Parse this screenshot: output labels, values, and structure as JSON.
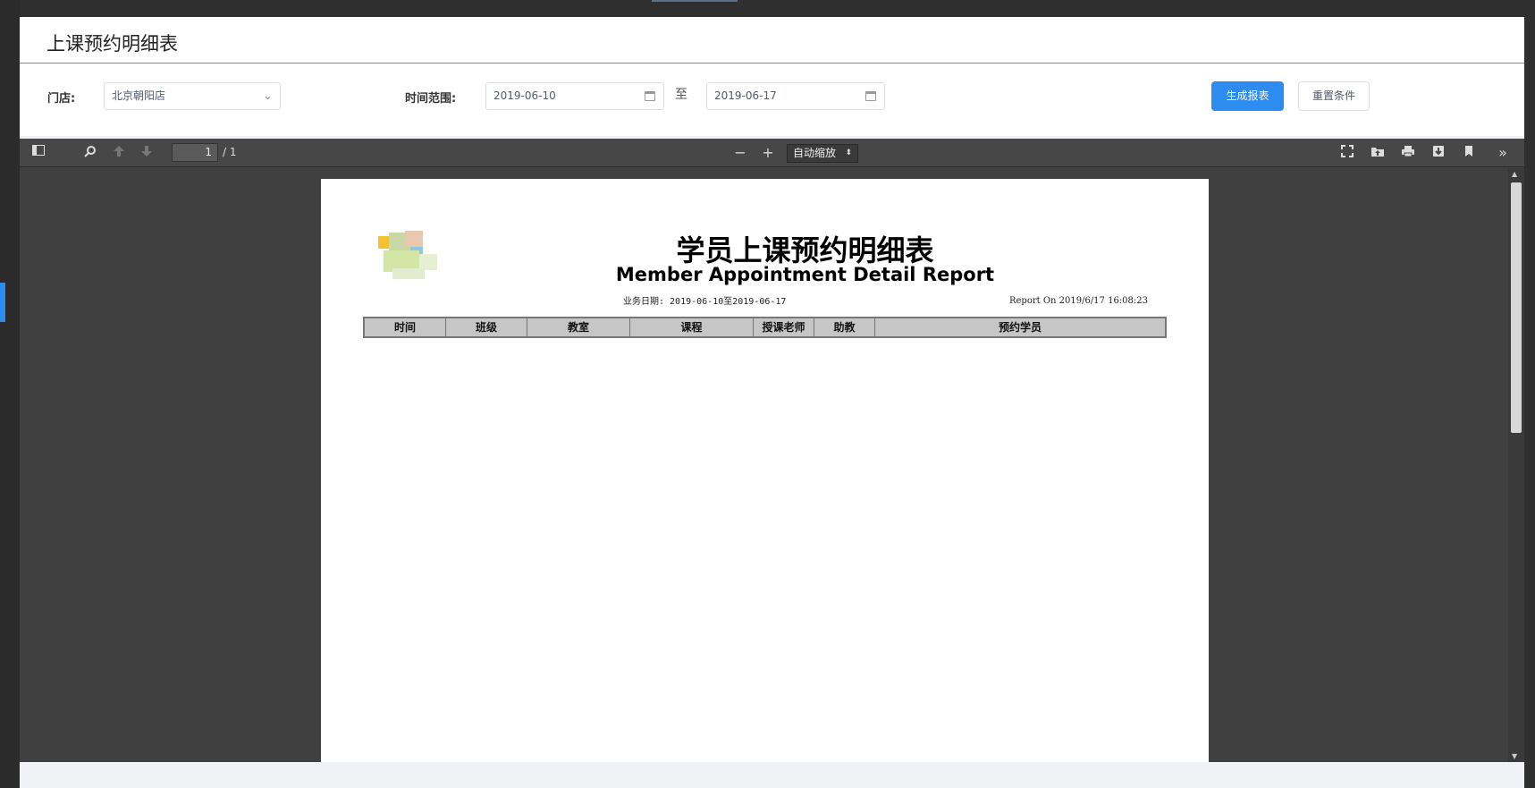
{
  "page": {
    "title": "上课预约明细表"
  },
  "filters": {
    "store_label": "门店:",
    "store_value": "北京朝阳店",
    "time_label": "时间范围:",
    "start_date": "2019-06-10",
    "range_separator": "至",
    "end_date": "2019-06-17",
    "generate_button": "生成报表",
    "reset_button": "重置条件"
  },
  "viewer": {
    "page_number": "1",
    "page_count": "/ 1",
    "zoom": "自动缩放",
    "zoom_out": "−",
    "zoom_in": "+"
  },
  "report": {
    "title_cn": "学员上课预约明细表",
    "title_en": "Member Appointment Detail Report",
    "business_date": "业务日期: 2019-06-10至2019-06-17",
    "report_on": "Report On 2019/6/17 16:08:23",
    "columns": [
      "时间",
      "班级",
      "教室",
      "课程",
      "授课老师",
      "助教",
      "预约学员"
    ]
  },
  "colors": {
    "primary": "#2d8cf0",
    "viewer_bg": "#404040",
    "toolbar_bg": "#474747"
  }
}
